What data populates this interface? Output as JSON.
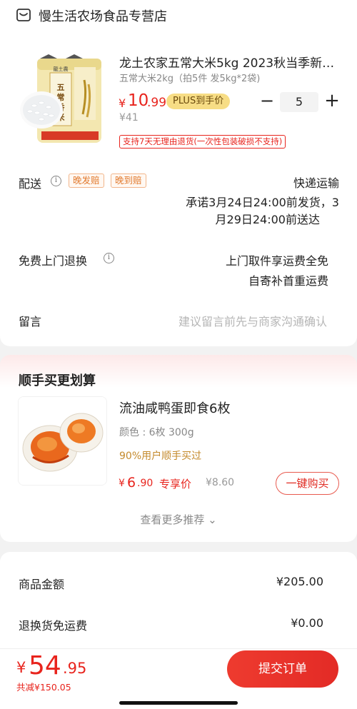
{
  "shop": {
    "name": "慢生活农场食品专营店",
    "icon": "store-icon"
  },
  "product": {
    "title": "龙土农家五常大米5kg  2023秋当季新米…",
    "spec": "五常大米2kg（拍5件 发5kg*2袋)",
    "price_symbol": "¥",
    "price_int": "10",
    "price_dec": ".99",
    "plus_label": "PLUS到手价",
    "original_price": "¥41",
    "quantity": "5",
    "minus_label": "−",
    "plus_sign": "+",
    "return_policy": "支持7天无理由退货(一次性包装破损不支持)",
    "bag_text": {
      "brand": "龍土農",
      "name": "五常香米"
    }
  },
  "delivery": {
    "label": "配送",
    "tags": [
      "晚发赔",
      "晚到赔"
    ],
    "method": "快递运输",
    "promise_line1": "承诺3月24日24:00前发货，3",
    "promise_line2": "月29日24:00前送达"
  },
  "pickup": {
    "label": "免费上门退换",
    "line1": "上门取件享运费全免",
    "line2": "自寄补首重运费"
  },
  "message": {
    "label": "留言",
    "placeholder": "建议留言前先与商家沟通确认"
  },
  "recommend": {
    "section_title": "顺手买更划算",
    "item_name": "流油咸鸭蛋即食6枚",
    "item_spec": "颜色 : 6枚 300g",
    "item_note": "90%用户顺手买过",
    "price_symbol": "¥",
    "price_int": "6",
    "price_dec": ".90",
    "price_label": "专享价",
    "original_price": "¥8.60",
    "buy_button": "一键购买",
    "more": "查看更多推荐 ⌄"
  },
  "summary": {
    "rows": [
      {
        "label": "商品金额",
        "value": "¥205.00"
      },
      {
        "label": "退换货免运费",
        "value": "¥0.00"
      }
    ]
  },
  "bottom": {
    "price_symbol": "¥",
    "price_int": "54",
    "price_dec": ".95",
    "saved": "共减¥150.05",
    "submit": "提交订单"
  },
  "colors": {
    "accent": "#e8241d",
    "plus_gold": "#f7dd85",
    "tag_orange": "#e27a2e"
  }
}
